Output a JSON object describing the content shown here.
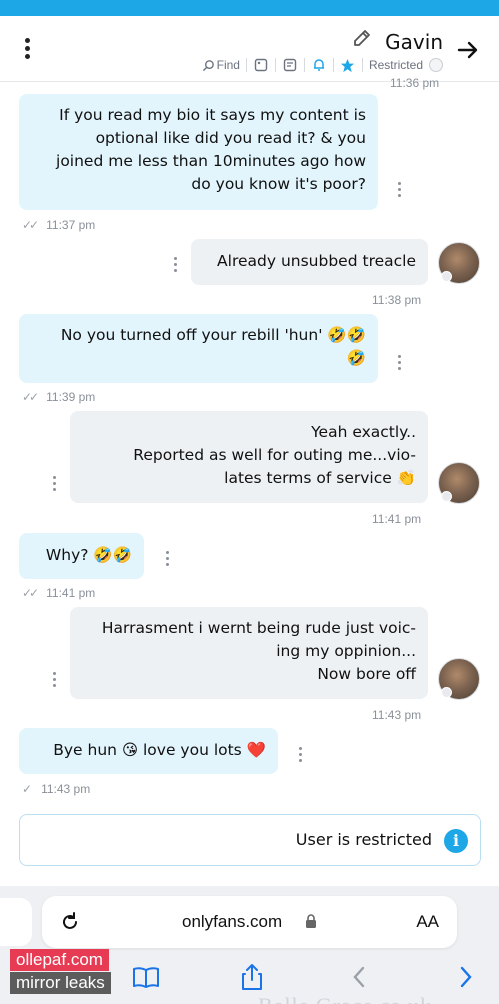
{
  "header": {
    "contact_name": "Gavin",
    "status_label": "Restricted",
    "find_label": "Find",
    "icons": [
      "back-arrow-icon",
      "edit-icon",
      "star-icon",
      "bell-icon",
      "notes-icon",
      "gallery-icon",
      "search-icon",
      "more-vert-icon"
    ]
  },
  "colors": {
    "accent": "#1ea7e6",
    "outgoing_bubble": "#e2f4fc",
    "incoming_bubble": "#eef1f4",
    "watermark_primary": "#e63b53",
    "watermark_secondary": "#5c5c5c"
  },
  "chat": {
    "top_partial_time": "11:36 pm",
    "messages": [
      {
        "direction": "out",
        "text": "If you read my bio it says my content is\noptional like did you read it? & you\njoined me less than 10minutes ago how\ndo you know it's poor?",
        "time": "11:37 pm"
      },
      {
        "direction": "in",
        "text": "Already unsubbed treacle",
        "time": "11:38 pm"
      },
      {
        "direction": "out",
        "text": "No you turned off your rebill 'hun' 🤣🤣\n🤣",
        "time": "11:39 pm"
      },
      {
        "direction": "in",
        "text": "Yeah exactly..\nReported as well for outing me...vio-\nlates terms of service 👏",
        "time": "11:41 pm"
      },
      {
        "direction": "out",
        "text": "Why? 🤣🤣",
        "time": "11:41 pm"
      },
      {
        "direction": "in",
        "text": "Harrasment i wernt being rude just voic-\ning my oppinion...\nNow bore off",
        "time": "11:43 pm"
      },
      {
        "direction": "out",
        "text": "Bye hun 😘 love you lots ❤️",
        "time": "11:43 pm"
      }
    ]
  },
  "restricted_notice": {
    "text": "User is restricted"
  },
  "browser": {
    "url": "onlyfans.com",
    "text_size_label": "AA",
    "toolbar_icons": [
      "back-chevron-icon",
      "forward-chevron-icon",
      "share-icon",
      "bookmarks-icon"
    ]
  },
  "watermark": {
    "line1": "ollepaf.com",
    "line2": "mirror leaks"
  },
  "page_bottom_text": "Belle Grace ca uk"
}
